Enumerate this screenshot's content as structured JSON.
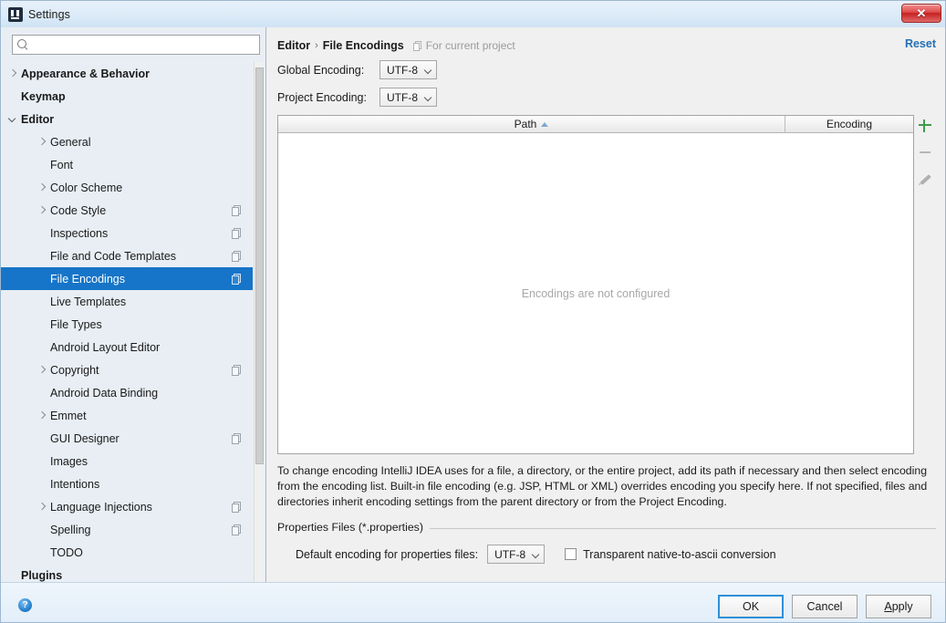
{
  "window": {
    "title": "Settings",
    "app_icon": "intellij-idea-icon",
    "close_label": "✕"
  },
  "sidebar": {
    "search": {
      "value": "",
      "placeholder": "",
      "icon": "search-icon"
    },
    "items": [
      {
        "label": "Appearance & Behavior",
        "depth": 0,
        "chevron": "right",
        "badge": false,
        "selected": false
      },
      {
        "label": "Keymap",
        "depth": 0,
        "chevron": "none",
        "badge": false,
        "selected": false
      },
      {
        "label": "Editor",
        "depth": 0,
        "chevron": "down",
        "badge": false,
        "selected": false
      },
      {
        "label": "General",
        "depth": 1,
        "chevron": "right",
        "badge": false,
        "selected": false
      },
      {
        "label": "Font",
        "depth": 1,
        "chevron": "none",
        "badge": false,
        "selected": false
      },
      {
        "label": "Color Scheme",
        "depth": 1,
        "chevron": "right",
        "badge": false,
        "selected": false
      },
      {
        "label": "Code Style",
        "depth": 1,
        "chevron": "right",
        "badge": true,
        "selected": false
      },
      {
        "label": "Inspections",
        "depth": 1,
        "chevron": "none",
        "badge": true,
        "selected": false
      },
      {
        "label": "File and Code Templates",
        "depth": 1,
        "chevron": "none",
        "badge": true,
        "selected": false
      },
      {
        "label": "File Encodings",
        "depth": 1,
        "chevron": "none",
        "badge": true,
        "selected": true
      },
      {
        "label": "Live Templates",
        "depth": 1,
        "chevron": "none",
        "badge": false,
        "selected": false
      },
      {
        "label": "File Types",
        "depth": 1,
        "chevron": "none",
        "badge": false,
        "selected": false
      },
      {
        "label": "Android Layout Editor",
        "depth": 1,
        "chevron": "none",
        "badge": false,
        "selected": false
      },
      {
        "label": "Copyright",
        "depth": 1,
        "chevron": "right",
        "badge": true,
        "selected": false
      },
      {
        "label": "Android Data Binding",
        "depth": 1,
        "chevron": "none",
        "badge": false,
        "selected": false
      },
      {
        "label": "Emmet",
        "depth": 1,
        "chevron": "right",
        "badge": false,
        "selected": false
      },
      {
        "label": "GUI Designer",
        "depth": 1,
        "chevron": "none",
        "badge": true,
        "selected": false
      },
      {
        "label": "Images",
        "depth": 1,
        "chevron": "none",
        "badge": false,
        "selected": false
      },
      {
        "label": "Intentions",
        "depth": 1,
        "chevron": "none",
        "badge": false,
        "selected": false
      },
      {
        "label": "Language Injections",
        "depth": 1,
        "chevron": "right",
        "badge": true,
        "selected": false
      },
      {
        "label": "Spelling",
        "depth": 1,
        "chevron": "none",
        "badge": true,
        "selected": false
      },
      {
        "label": "TODO",
        "depth": 1,
        "chevron": "none",
        "badge": false,
        "selected": false
      },
      {
        "label": "Plugins",
        "depth": 0,
        "chevron": "none",
        "badge": false,
        "selected": false
      }
    ]
  },
  "panel": {
    "breadcrumb": {
      "parent": "Editor",
      "separator": "›",
      "current": "File Encodings"
    },
    "scope_note": "For current project",
    "reset_label": "Reset",
    "global_encoding": {
      "label": "Global Encoding:",
      "value": "UTF-8"
    },
    "project_encoding": {
      "label": "Project Encoding:",
      "value": "UTF-8"
    },
    "table": {
      "columns": [
        "Path",
        "Encoding"
      ],
      "sort_column": "Path",
      "sort_direction": "ascending",
      "rows": [],
      "empty_message": "Encodings are not configured",
      "tools": [
        {
          "name": "add",
          "icon": "plus-icon",
          "color": "#3f9c4a"
        },
        {
          "name": "remove",
          "icon": "minus-icon",
          "color": "#b6b6b6"
        },
        {
          "name": "edit",
          "icon": "pencil-icon",
          "color": "#b0b0b0"
        }
      ]
    },
    "description": "To change encoding IntelliJ IDEA uses for a file, a directory, or the entire project, add its path if necessary and then select encoding from the encoding list. Built-in file encoding (e.g. JSP, HTML or XML) overrides encoding you specify here. If not specified, files and directories inherit encoding settings from the parent directory or from the Project Encoding.",
    "properties_group": {
      "title": "Properties Files (*.properties)",
      "default_encoding_label": "Default encoding for properties files:",
      "default_encoding_value": "UTF-8",
      "transparent_label": "Transparent native-to-ascii conversion",
      "transparent_checked": false
    }
  },
  "footer": {
    "help_glyph": "?",
    "ok_label": "OK",
    "cancel_label": "Cancel",
    "apply_label": "Apply"
  },
  "colors": {
    "selection": "#1675c8",
    "link": "#2470b3",
    "add_icon": "#3f9c4a",
    "close_button": "#c62020"
  }
}
